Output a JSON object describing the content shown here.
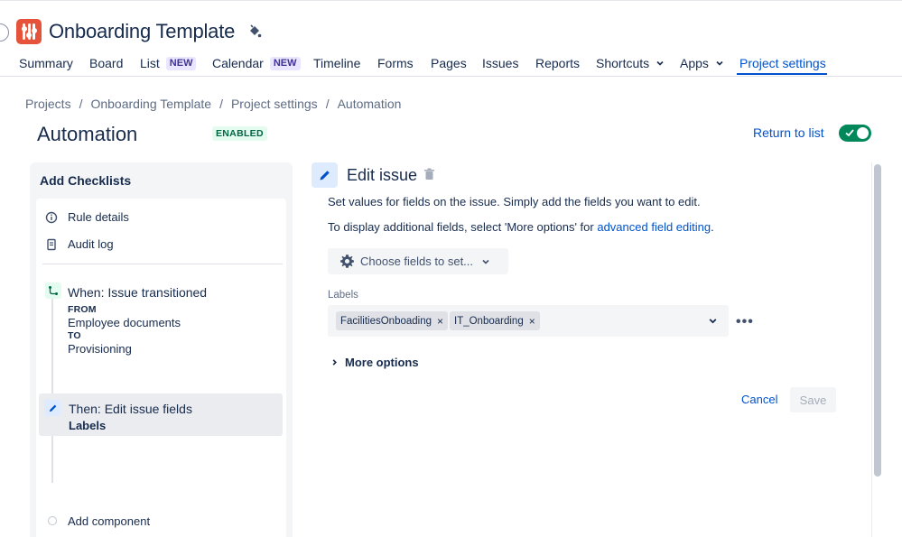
{
  "project": {
    "title": "Onboarding Template"
  },
  "nav": {
    "items": [
      {
        "label": "Summary"
      },
      {
        "label": "Board"
      },
      {
        "label": "List",
        "badge": "NEW"
      },
      {
        "label": "Calendar",
        "badge": "NEW"
      },
      {
        "label": "Timeline"
      },
      {
        "label": "Forms"
      },
      {
        "label": "Pages"
      },
      {
        "label": "Issues"
      },
      {
        "label": "Reports"
      },
      {
        "label": "Shortcuts",
        "dropdown": true
      },
      {
        "label": "Apps",
        "dropdown": true
      },
      {
        "label": "Project settings",
        "active": true
      }
    ]
  },
  "breadcrumb": {
    "items": [
      "Projects",
      "Onboarding Template",
      "Project settings",
      "Automation"
    ],
    "separator": "/"
  },
  "page": {
    "title": "Automation",
    "status_badge": "ENABLED",
    "return_link": "Return to list",
    "enabled_toggle": true
  },
  "rule": {
    "name": "Add Checklists",
    "menu": {
      "rule_details": "Rule details",
      "audit_log": "Audit log"
    },
    "trigger": {
      "title": "When: Issue transitioned",
      "from_label": "FROM",
      "from_value": "Employee documents",
      "to_label": "TO",
      "to_value": "Provisioning"
    },
    "action": {
      "title": "Then: Edit issue fields",
      "subtitle": "Labels"
    },
    "add_component": "Add component"
  },
  "editor": {
    "title": "Edit issue",
    "description": "Set values for fields on the issue. Simply add the fields you want to edit.",
    "hint_prefix": "To display additional fields, select 'More options' for ",
    "hint_link": "advanced field editing",
    "hint_suffix": ".",
    "choose_fields": "Choose fields to set...",
    "labels_caption": "Labels",
    "labels": [
      "FacilitiesOnboading",
      "IT_Onboarding"
    ],
    "more_options": "More options",
    "cancel": "Cancel",
    "save": "Save"
  },
  "colors": {
    "accent": "#0052cc",
    "logo": "#e5533b",
    "toggle_on": "#00875a",
    "enabled_text": "#006644",
    "new_badge_bg": "#eae6ff"
  }
}
